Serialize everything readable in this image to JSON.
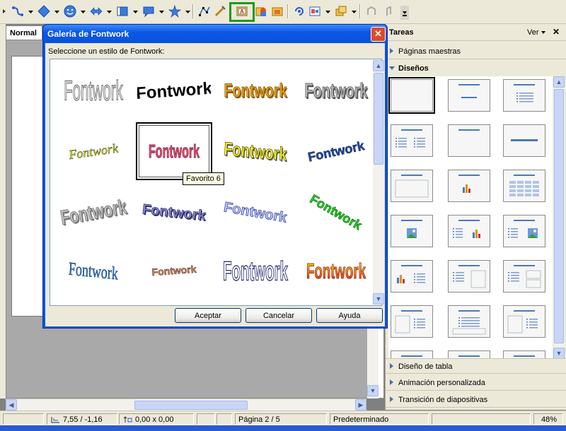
{
  "toolbar": {
    "icons": [
      "connector-icon",
      "basic-shapes-icon",
      "smiley-icon",
      "block-arrows-icon",
      "flowchart-icon",
      "callout-icon",
      "stars-icon",
      "points-icon",
      "glue-icon",
      "fontwork-gallery-icon",
      "from-file-icon",
      "insert-image-icon",
      "rotate-icon",
      "alignment-icon",
      "arrange-icon",
      "extrusion-on-icon",
      "extrusion-icon"
    ]
  },
  "document": {
    "tab_normal": "Normal"
  },
  "dialog": {
    "title": "Galería de Fontwork",
    "close_glyph": "✕",
    "label": "Seleccione un estilo de Fontwork:",
    "items": [
      {
        "text": "Fontwork",
        "style": "outline-gray"
      },
      {
        "text": "Fontwork",
        "style": "black-arch"
      },
      {
        "text": "Fontwork",
        "style": "orange-3d"
      },
      {
        "text": "Fontwork",
        "style": "gray-3d"
      },
      {
        "text": "Fontwork",
        "style": "yellow-slant"
      },
      {
        "text": "Fontwork",
        "style": "red-perspective"
      },
      {
        "text": "Fontwork",
        "style": "yellow-3d"
      },
      {
        "text": "Fontwork",
        "style": "blue-wave"
      },
      {
        "text": "Fontwork",
        "style": "gray-extrude"
      },
      {
        "text": "Fontwork",
        "style": "blue-3d"
      },
      {
        "text": "Fontwork",
        "style": "blue-wave-outline"
      },
      {
        "text": "Fontwork",
        "style": "green-circle"
      },
      {
        "text": "Fontwork",
        "style": "teal-slant"
      },
      {
        "text": "Fontwork",
        "style": "brown-arc"
      },
      {
        "text": "Fontwork",
        "style": "purple-outline"
      },
      {
        "text": "Fontwork",
        "style": "fire-gradient"
      }
    ],
    "tooltip": "Favorito 6",
    "buttons": {
      "ok": "Aceptar",
      "cancel": "Cancelar",
      "help": "Ayuda"
    }
  },
  "tasks": {
    "title": "Tareas",
    "view_menu": "Ver",
    "close_glyph": "✕",
    "sections": {
      "master_pages": "Páginas maestras",
      "layouts": "Diseños",
      "table_design": "Diseño de tabla",
      "custom_animation": "Animación personalizada",
      "slide_transition": "Transición de diapositivas"
    }
  },
  "status": {
    "position": "7,55 / -1,16",
    "size": "0,00 x 0,00",
    "page": "Página 2 / 5",
    "master": "Predeterminado",
    "zoom": "48%"
  },
  "colors": {
    "accent_green": "#1d9a1d",
    "title_blue": "#0c58e6",
    "close_red": "#e04a28"
  }
}
